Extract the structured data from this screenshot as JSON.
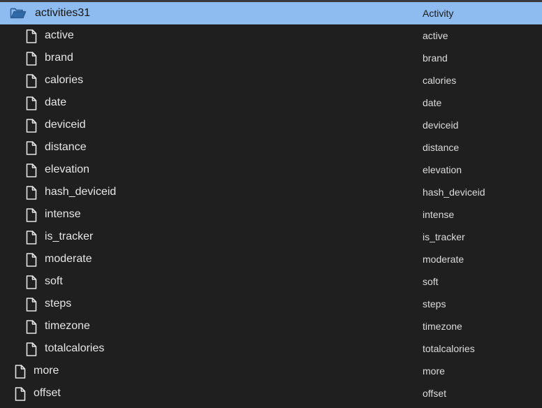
{
  "tree": {
    "folder": {
      "name": "activities31",
      "type": "Activity",
      "icon": "folder-open-icon",
      "selected": true
    },
    "children": [
      {
        "name": "active",
        "type": "active",
        "icon": "file-icon"
      },
      {
        "name": "brand",
        "type": "brand",
        "icon": "file-icon"
      },
      {
        "name": "calories",
        "type": "calories",
        "icon": "file-icon"
      },
      {
        "name": "date",
        "type": "date",
        "icon": "file-icon"
      },
      {
        "name": "deviceid",
        "type": "deviceid",
        "icon": "file-icon"
      },
      {
        "name": "distance",
        "type": "distance",
        "icon": "file-icon"
      },
      {
        "name": "elevation",
        "type": "elevation",
        "icon": "file-icon"
      },
      {
        "name": "hash_deviceid",
        "type": "hash_deviceid",
        "icon": "file-icon"
      },
      {
        "name": "intense",
        "type": "intense",
        "icon": "file-icon"
      },
      {
        "name": "is_tracker",
        "type": "is_tracker",
        "icon": "file-icon"
      },
      {
        "name": "moderate",
        "type": "moderate",
        "icon": "file-icon"
      },
      {
        "name": "soft",
        "type": "soft",
        "icon": "file-icon"
      },
      {
        "name": "steps",
        "type": "steps",
        "icon": "file-icon"
      },
      {
        "name": "timezone",
        "type": "timezone",
        "icon": "file-icon"
      },
      {
        "name": "totalcalories",
        "type": "totalcalories",
        "icon": "file-icon"
      }
    ],
    "top_level": [
      {
        "name": "more",
        "type": "more",
        "icon": "file-icon"
      },
      {
        "name": "offset",
        "type": "offset",
        "icon": "file-icon"
      }
    ]
  },
  "colors": {
    "background": "#1f1f1f",
    "selection": "#8ebcf0",
    "text": "#e6e6e6"
  }
}
